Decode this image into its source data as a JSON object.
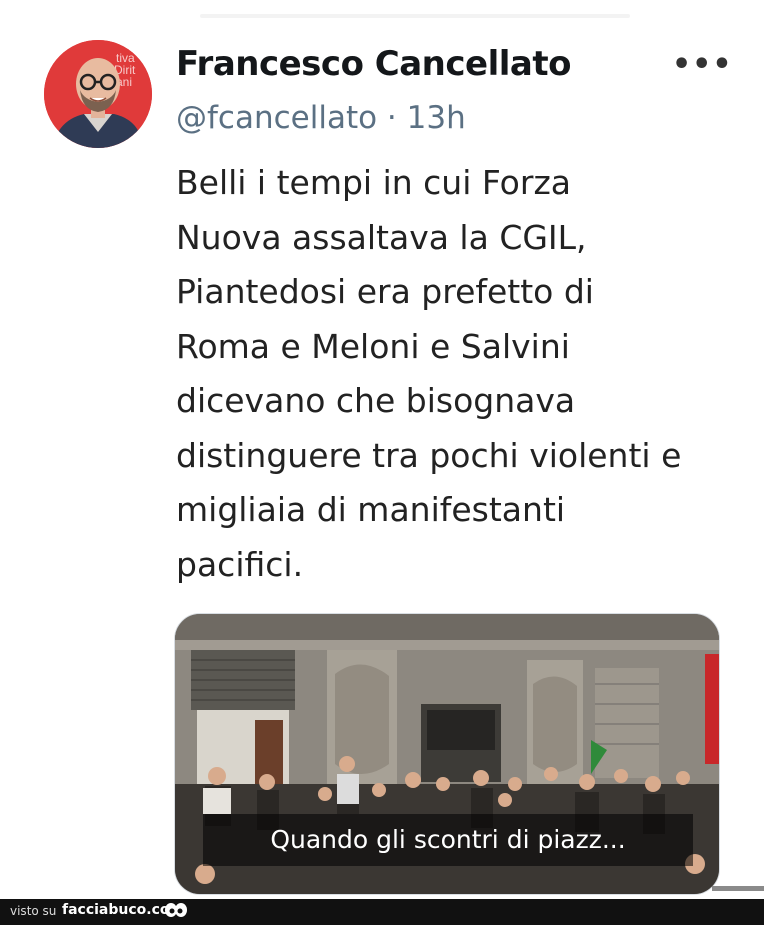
{
  "author": {
    "name": "Francesco Cancellato",
    "handle": "@fcancellato",
    "separator": "·",
    "time": "13h",
    "avatar_banner": [
      "tiva",
      "Dirit",
      "ani"
    ]
  },
  "more_icon": "more-horizontal-icon",
  "tweet_lines": [
    "Belli i tempi in cui Forza",
    "Nuova assaltava la CGIL,",
    "Piantedosi era prefetto di",
    "Roma e Meloni e Salvini",
    "dicevano che bisognava",
    "distinguere tra pochi violenti e",
    "migliaia di manifestanti",
    "pacifici."
  ],
  "media": {
    "caption": "Quando gli scontri di piazz..."
  },
  "footer": {
    "visto": "visto su",
    "brand": "facciabuco.com"
  },
  "colors": {
    "handle": "#5b7083",
    "footer_bg": "#111111",
    "avatar_bg": "#e03a3a"
  }
}
